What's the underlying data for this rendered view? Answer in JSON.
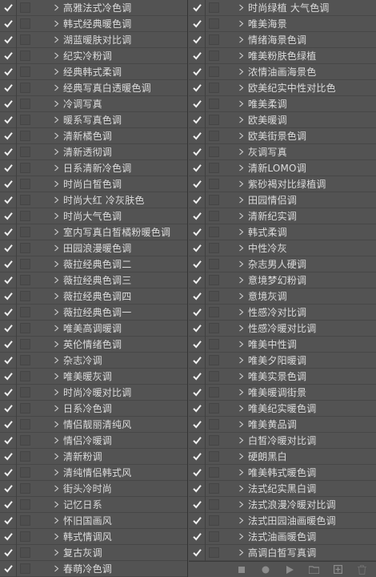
{
  "colors": {
    "panel_bg": "#535353",
    "text": "#dcdcdc",
    "check": "#f0f0f0",
    "row_border": "#474747"
  },
  "left_panel": {
    "items": [
      {
        "label": "高雅法式冷色调",
        "checked": true
      },
      {
        "label": "韩式经典暖色调",
        "checked": true
      },
      {
        "label": "湖蓝暖肤对比调",
        "checked": true
      },
      {
        "label": "纪实冷粉调",
        "checked": true
      },
      {
        "label": "经典韩式柔调",
        "checked": true
      },
      {
        "label": "经典写真白透暖色调",
        "checked": true
      },
      {
        "label": "冷调写真",
        "checked": true
      },
      {
        "label": "暖系写真色调",
        "checked": true
      },
      {
        "label": "清新橘色调",
        "checked": true
      },
      {
        "label": "清新透彻调",
        "checked": true
      },
      {
        "label": "日系清新冷色调",
        "checked": true
      },
      {
        "label": "时尚白皙色调",
        "checked": true
      },
      {
        "label": "时尚大红 冷灰肤色",
        "checked": true
      },
      {
        "label": "时尚大气色调",
        "checked": true
      },
      {
        "label": "室内写真白皙橘粉暖色调",
        "checked": true
      },
      {
        "label": "田园浪漫暖色调",
        "checked": true
      },
      {
        "label": "薇拉经典色调二",
        "checked": true
      },
      {
        "label": "薇拉经典色调三",
        "checked": true
      },
      {
        "label": "薇拉经典色调四",
        "checked": true
      },
      {
        "label": "薇拉经典色调一",
        "checked": true
      },
      {
        "label": "唯美高调暖调",
        "checked": true
      },
      {
        "label": "英伦情绪色调",
        "checked": true
      },
      {
        "label": "杂志冷调",
        "checked": true
      },
      {
        "label": "唯美暖灰调",
        "checked": true
      },
      {
        "label": "时尚冷暖对比调",
        "checked": true
      },
      {
        "label": "日系冷色调",
        "checked": true
      },
      {
        "label": "情侣靓丽清纯风",
        "checked": true
      },
      {
        "label": "情侣冷暖调",
        "checked": true
      },
      {
        "label": "清新粉调",
        "checked": true
      },
      {
        "label": "清纯情侣韩式风",
        "checked": true
      },
      {
        "label": "街头冷时尚",
        "checked": true
      },
      {
        "label": "记忆日系",
        "checked": true
      },
      {
        "label": "怀旧国画风",
        "checked": true
      },
      {
        "label": "韩式情调风",
        "checked": true
      },
      {
        "label": "复古灰调",
        "checked": true
      },
      {
        "label": "春萌冷色调",
        "checked": true
      }
    ]
  },
  "right_panel": {
    "items": [
      {
        "label": "时尚绿植 大气色调",
        "checked": true
      },
      {
        "label": "唯美海景",
        "checked": true
      },
      {
        "label": "情绪海景色调",
        "checked": true
      },
      {
        "label": "唯美粉肤色绿植",
        "checked": true
      },
      {
        "label": "浓情油画海景色",
        "checked": true
      },
      {
        "label": "欧美纪实中性对比色",
        "checked": true
      },
      {
        "label": "唯美柔调",
        "checked": true
      },
      {
        "label": "欧美暖调",
        "checked": true
      },
      {
        "label": "欧美街景色调",
        "checked": true
      },
      {
        "label": "灰调写真",
        "checked": true
      },
      {
        "label": "清新LOMO调",
        "checked": true
      },
      {
        "label": "紫砂褐对比绿植调",
        "checked": true
      },
      {
        "label": "田园情侣调",
        "checked": true
      },
      {
        "label": "清新纪实调",
        "checked": true
      },
      {
        "label": "韩式柔调",
        "checked": true
      },
      {
        "label": "中性冷灰",
        "checked": true
      },
      {
        "label": "杂志男人硬调",
        "checked": true
      },
      {
        "label": "意境梦幻粉调",
        "checked": true
      },
      {
        "label": "意境灰调",
        "checked": true
      },
      {
        "label": "性感冷对比调",
        "checked": true
      },
      {
        "label": "性感冷暖对比调",
        "checked": true
      },
      {
        "label": "唯美中性调",
        "checked": true
      },
      {
        "label": "唯美夕阳暖调",
        "checked": true
      },
      {
        "label": "唯美实景色调",
        "checked": true
      },
      {
        "label": "唯美暖调街景",
        "checked": true
      },
      {
        "label": "唯美纪实暖色调",
        "checked": true
      },
      {
        "label": "唯美黄品调",
        "checked": true
      },
      {
        "label": "白皙冷暖对比调",
        "checked": true
      },
      {
        "label": "硬朗黑白",
        "checked": true
      },
      {
        "label": "唯美韩式暖色调",
        "checked": true
      },
      {
        "label": "法式纪实黑白调",
        "checked": true
      },
      {
        "label": "法式浪漫冷暖对比调",
        "checked": true
      },
      {
        "label": "法式田园油画暖色调",
        "checked": true
      },
      {
        "label": "法式油画暖色调",
        "checked": true
      },
      {
        "label": "高调白皙写真调",
        "checked": true
      }
    ]
  },
  "bottom_bar": {
    "buttons": [
      {
        "name": "stop-button",
        "icon": "stop-icon"
      },
      {
        "name": "record-button",
        "icon": "record-icon"
      },
      {
        "name": "play-button",
        "icon": "play-icon"
      },
      {
        "name": "new-set-button",
        "icon": "folder-icon"
      },
      {
        "name": "new-action-button",
        "icon": "new-item-icon"
      },
      {
        "name": "delete-button",
        "icon": "trash-icon"
      }
    ]
  }
}
